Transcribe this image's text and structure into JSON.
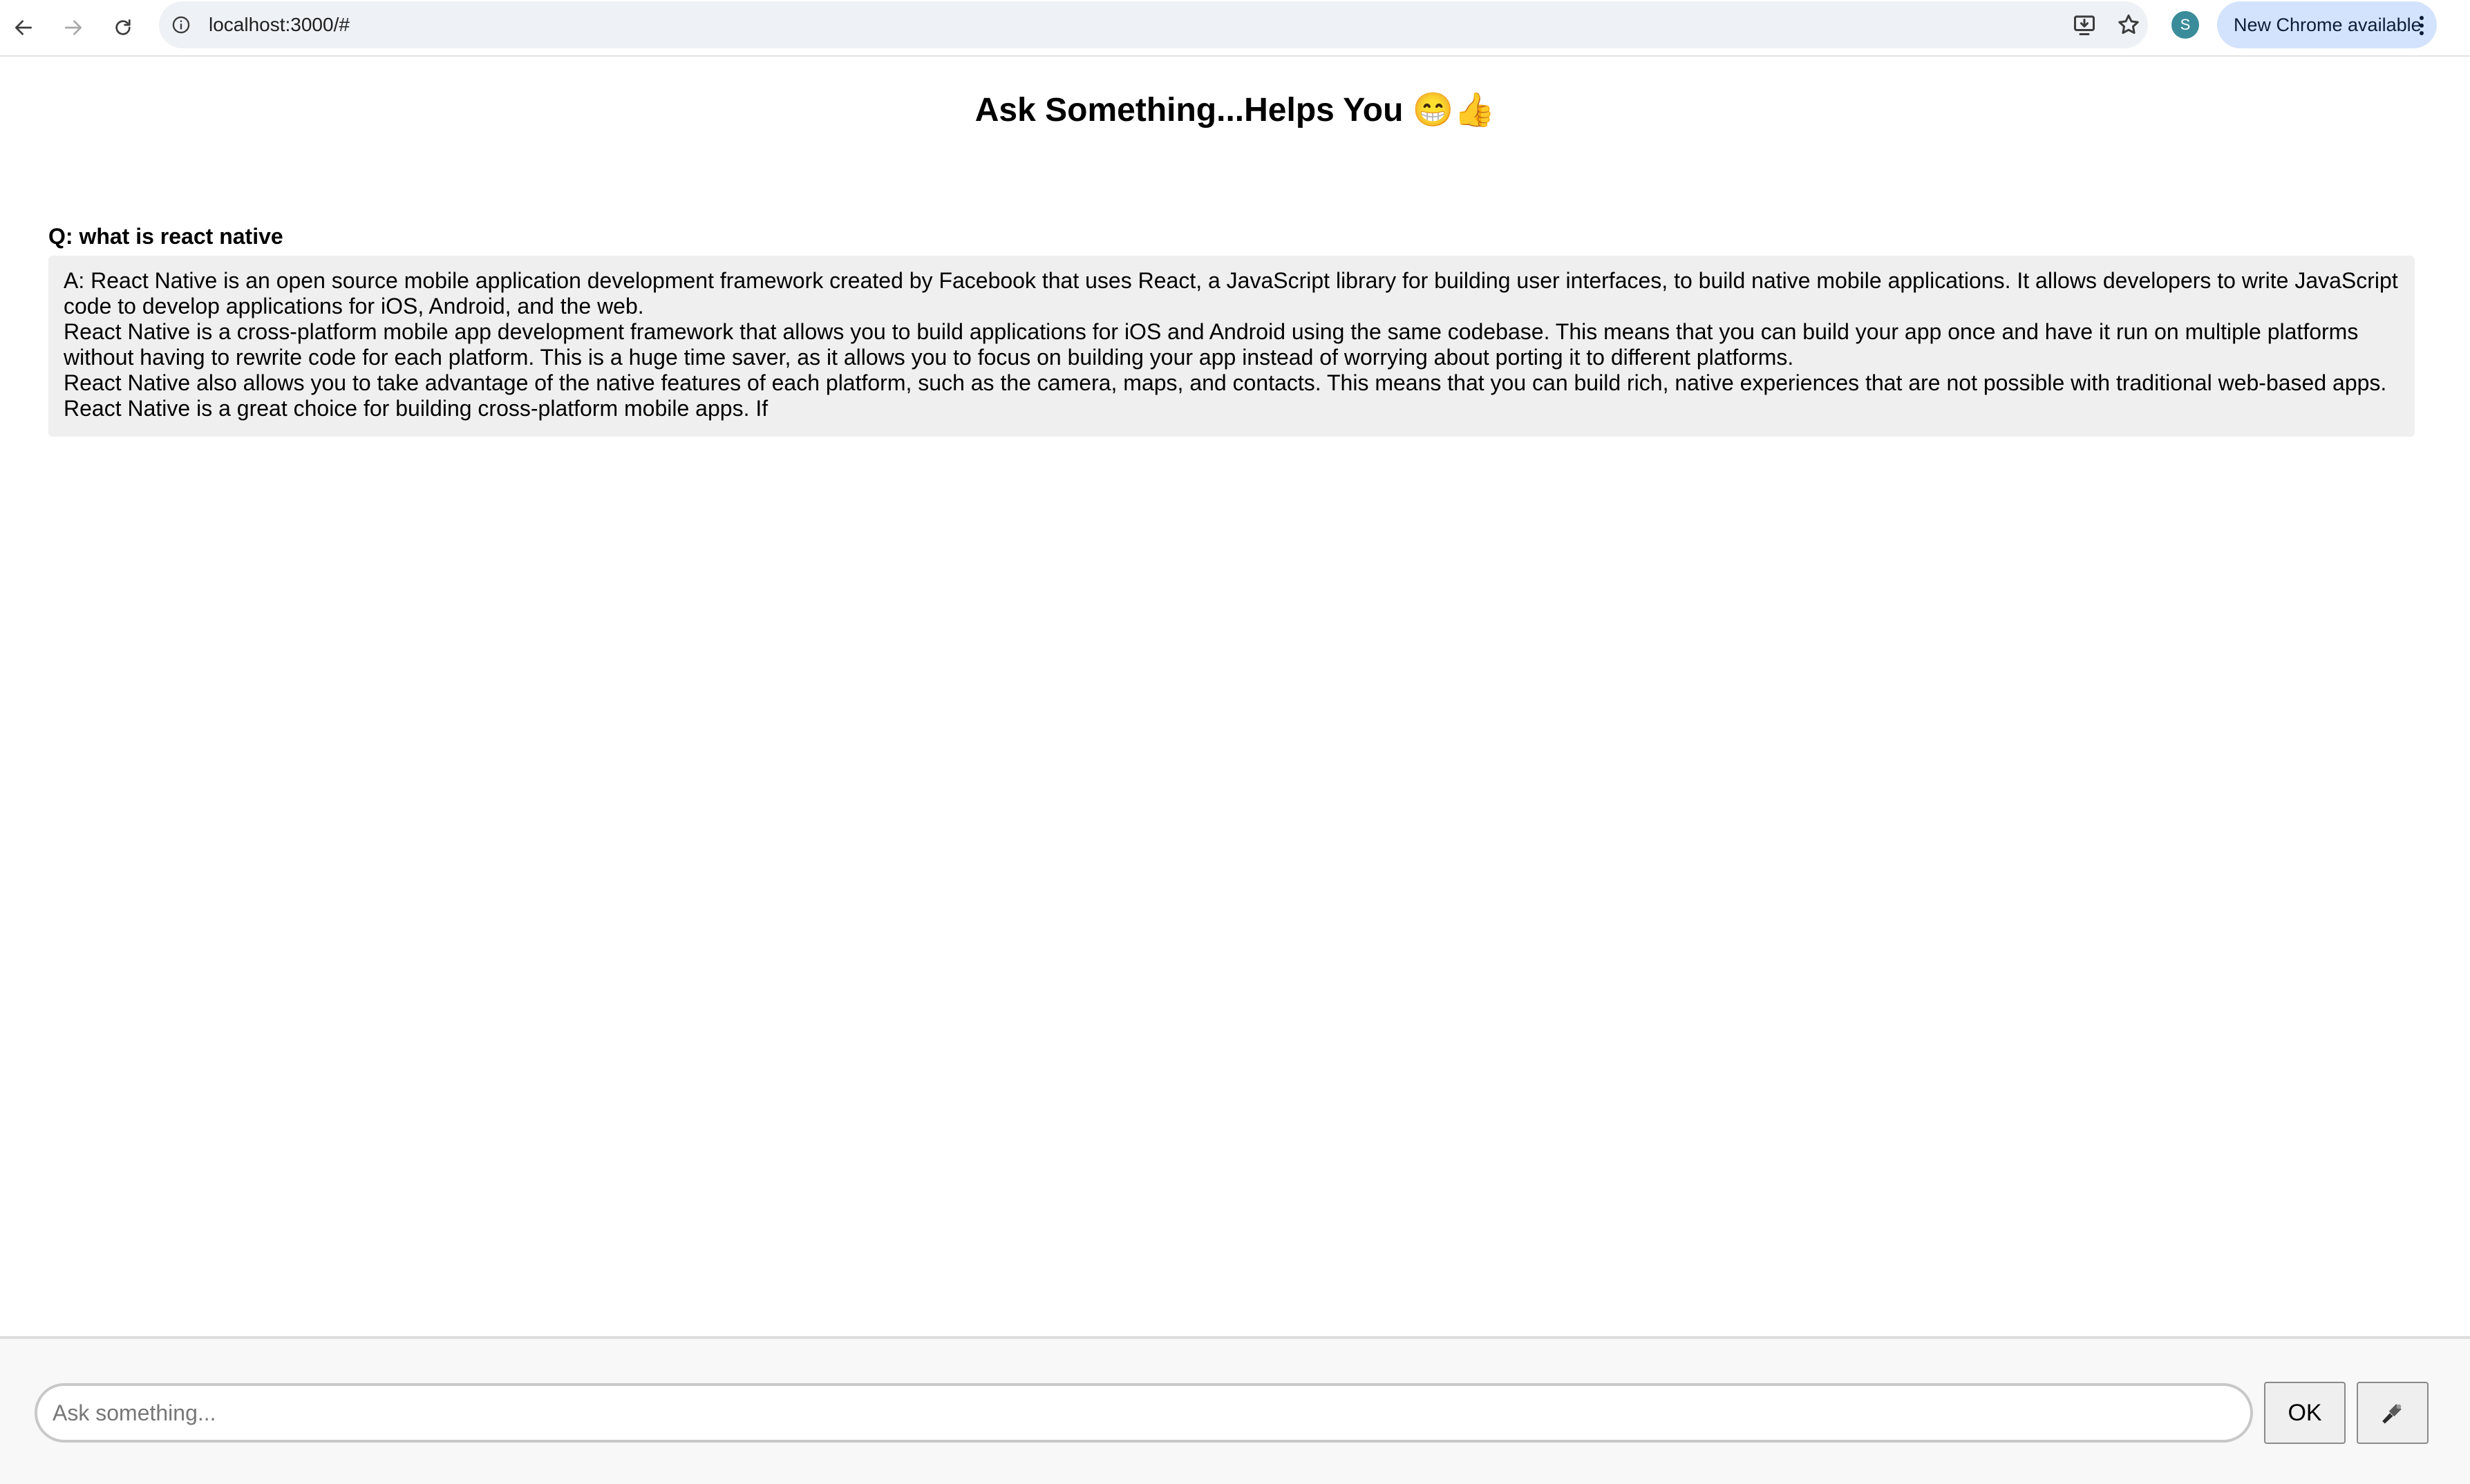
{
  "browser": {
    "url": "localhost:3000/#",
    "profile_initial": "S",
    "update_label": "New Chrome available",
    "icons": {
      "back": "arrow-left-icon",
      "forward": "arrow-right-icon",
      "reload": "reload-icon",
      "site_info": "info-icon",
      "install": "install-app-icon",
      "bookmark": "star-icon",
      "menu": "kebab-menu-icon"
    },
    "colors": {
      "omnibox": "#eef1f5",
      "update_chip": "#d3e3fd",
      "avatar": "#3a8c9a"
    }
  },
  "page": {
    "title": "Ask Something...Helps You 😁👍",
    "question": "Q: what is react native",
    "answer_lines": [
      "A: React Native is an open source mobile application development framework created by Facebook that uses React, a JavaScript library for building user interfaces, to build native mobile applications. It allows developers to write JavaScript code to develop applications for iOS, Android, and the web.",
      "React Native is a cross-platform mobile app development framework that allows you to build applications for iOS and Android using the same codebase. This means that you can build your app once and have it run on multiple platforms without having to rewrite code for each platform. This is a huge time saver, as it allows you to focus on building your app instead of worrying about porting it to different platforms.",
      "React Native also allows you to take advantage of the native features of each platform, such as the camera, maps, and contacts. This means that you can build rich, native experiences that are not possible with traditional web-based apps.",
      "React Native is a great choice for building cross-platform mobile apps. If"
    ]
  },
  "composer": {
    "placeholder": "Ask something...",
    "value": "",
    "ok_label": "OK",
    "mic_icon": "microphone-icon"
  }
}
